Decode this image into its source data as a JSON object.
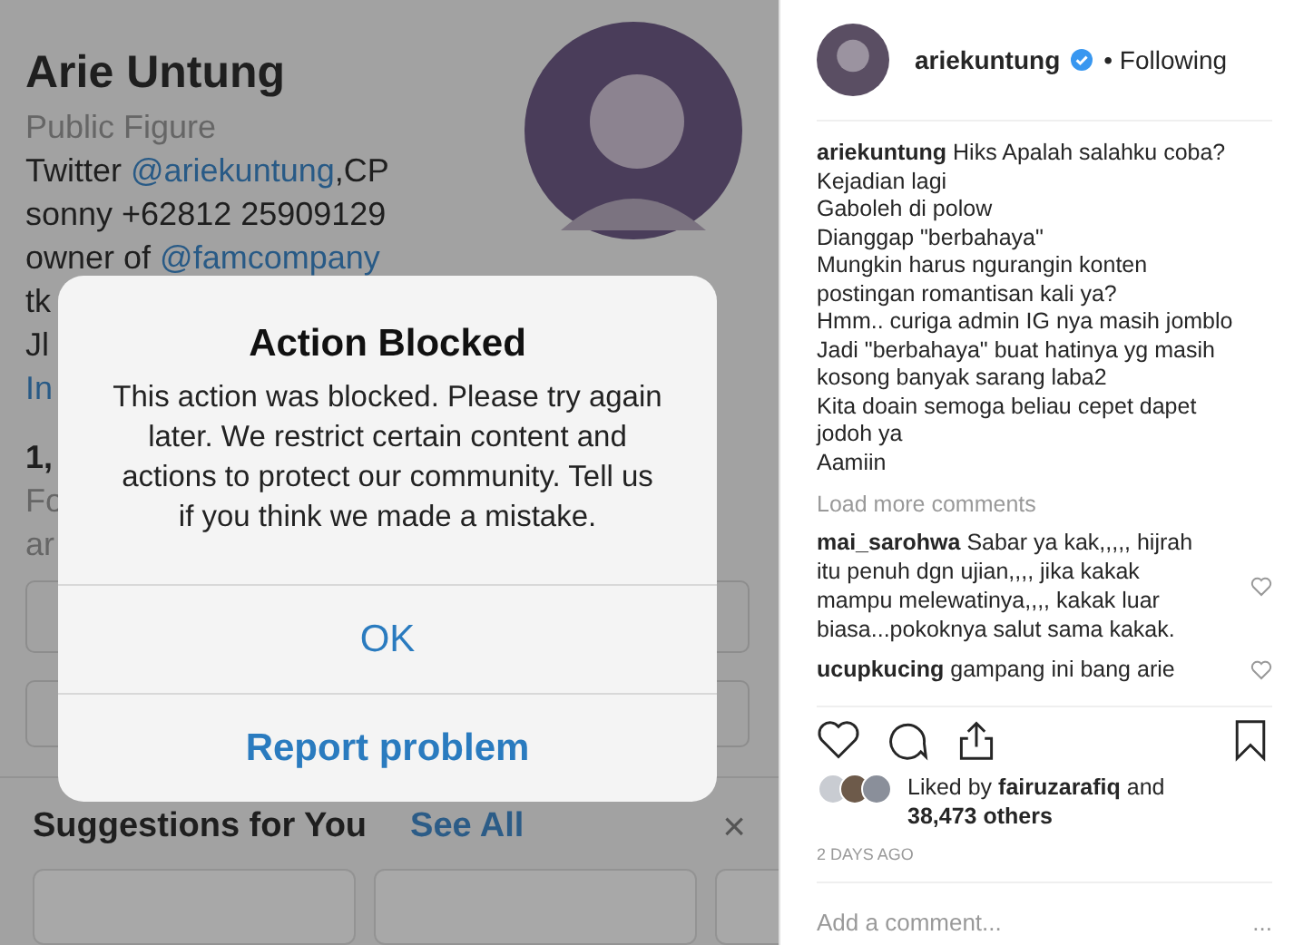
{
  "profile": {
    "name": "Arie Untung",
    "category": "Public Figure",
    "bio_lines": [
      {
        "parts": [
          {
            "text": "Twitter ",
            "link": false
          },
          {
            "text": "@ariekuntung",
            "link": true
          },
          {
            "text": ",CP",
            "link": false
          }
        ]
      },
      {
        "parts": [
          {
            "text": "sonny +62812 25909129",
            "link": false
          }
        ]
      },
      {
        "parts": [
          {
            "text": "owner of ",
            "link": false
          },
          {
            "text": "@famcompany",
            "link": true
          }
        ]
      },
      {
        "parts": [
          {
            "text": "tk",
            "link": false
          }
        ]
      },
      {
        "parts": [
          {
            "text": "Jl",
            "link": false
          }
        ]
      },
      {
        "parts": [
          {
            "text": "In",
            "link": true
          }
        ]
      }
    ],
    "stats_fragment": "1,",
    "follow_lines": [
      "Fo",
      "ar"
    ]
  },
  "dialog": {
    "title": "Action Blocked",
    "message": "This action was blocked. Please try again later. We restrict certain content and actions to protect our community. Tell us if you think we made a mistake.",
    "buttons": [
      {
        "label": "OK",
        "kind": "plain"
      },
      {
        "label": "Report problem",
        "kind": "strong"
      }
    ]
  },
  "suggestions": {
    "title": "Suggestions for You",
    "see_all": "See All",
    "close": "×"
  },
  "post": {
    "username": "ariekuntung",
    "verified": true,
    "following": "• Following",
    "caption_user": "ariekuntung",
    "caption_lines": [
      "Hiks Apalah salahku coba?",
      "Kejadian lagi",
      "Gaboleh di polow",
      "Dianggap \"berbahaya\"",
      "Mungkin harus ngurangin konten",
      "postingan romantisan kali ya?",
      "Hmm.. curiga admin IG nya masih jomblo",
      "Jadi \"berbahaya\" buat hatinya yg masih",
      "kosong banyak sarang laba2",
      "Kita doain semoga beliau cepet dapet",
      "jodoh ya",
      "Aamiin"
    ],
    "load_more": "Load more comments",
    "comments": [
      {
        "user": "mai_sarohwa",
        "text": "Sabar ya kak,,,,, hijrah itu penuh dgn ujian,,,, jika kakak mampu melewatinya,,,, kakak luar biasa...pokoknya salut sama kakak."
      },
      {
        "user": "ucupkucing",
        "text": "gampang ini bang arie"
      }
    ],
    "likes": "Liked by **fairuzarafiq** and **38,473 others**",
    "time": "2 DAYS AGO",
    "comment_placeholder": "Add a comment...",
    "more": "..."
  }
}
